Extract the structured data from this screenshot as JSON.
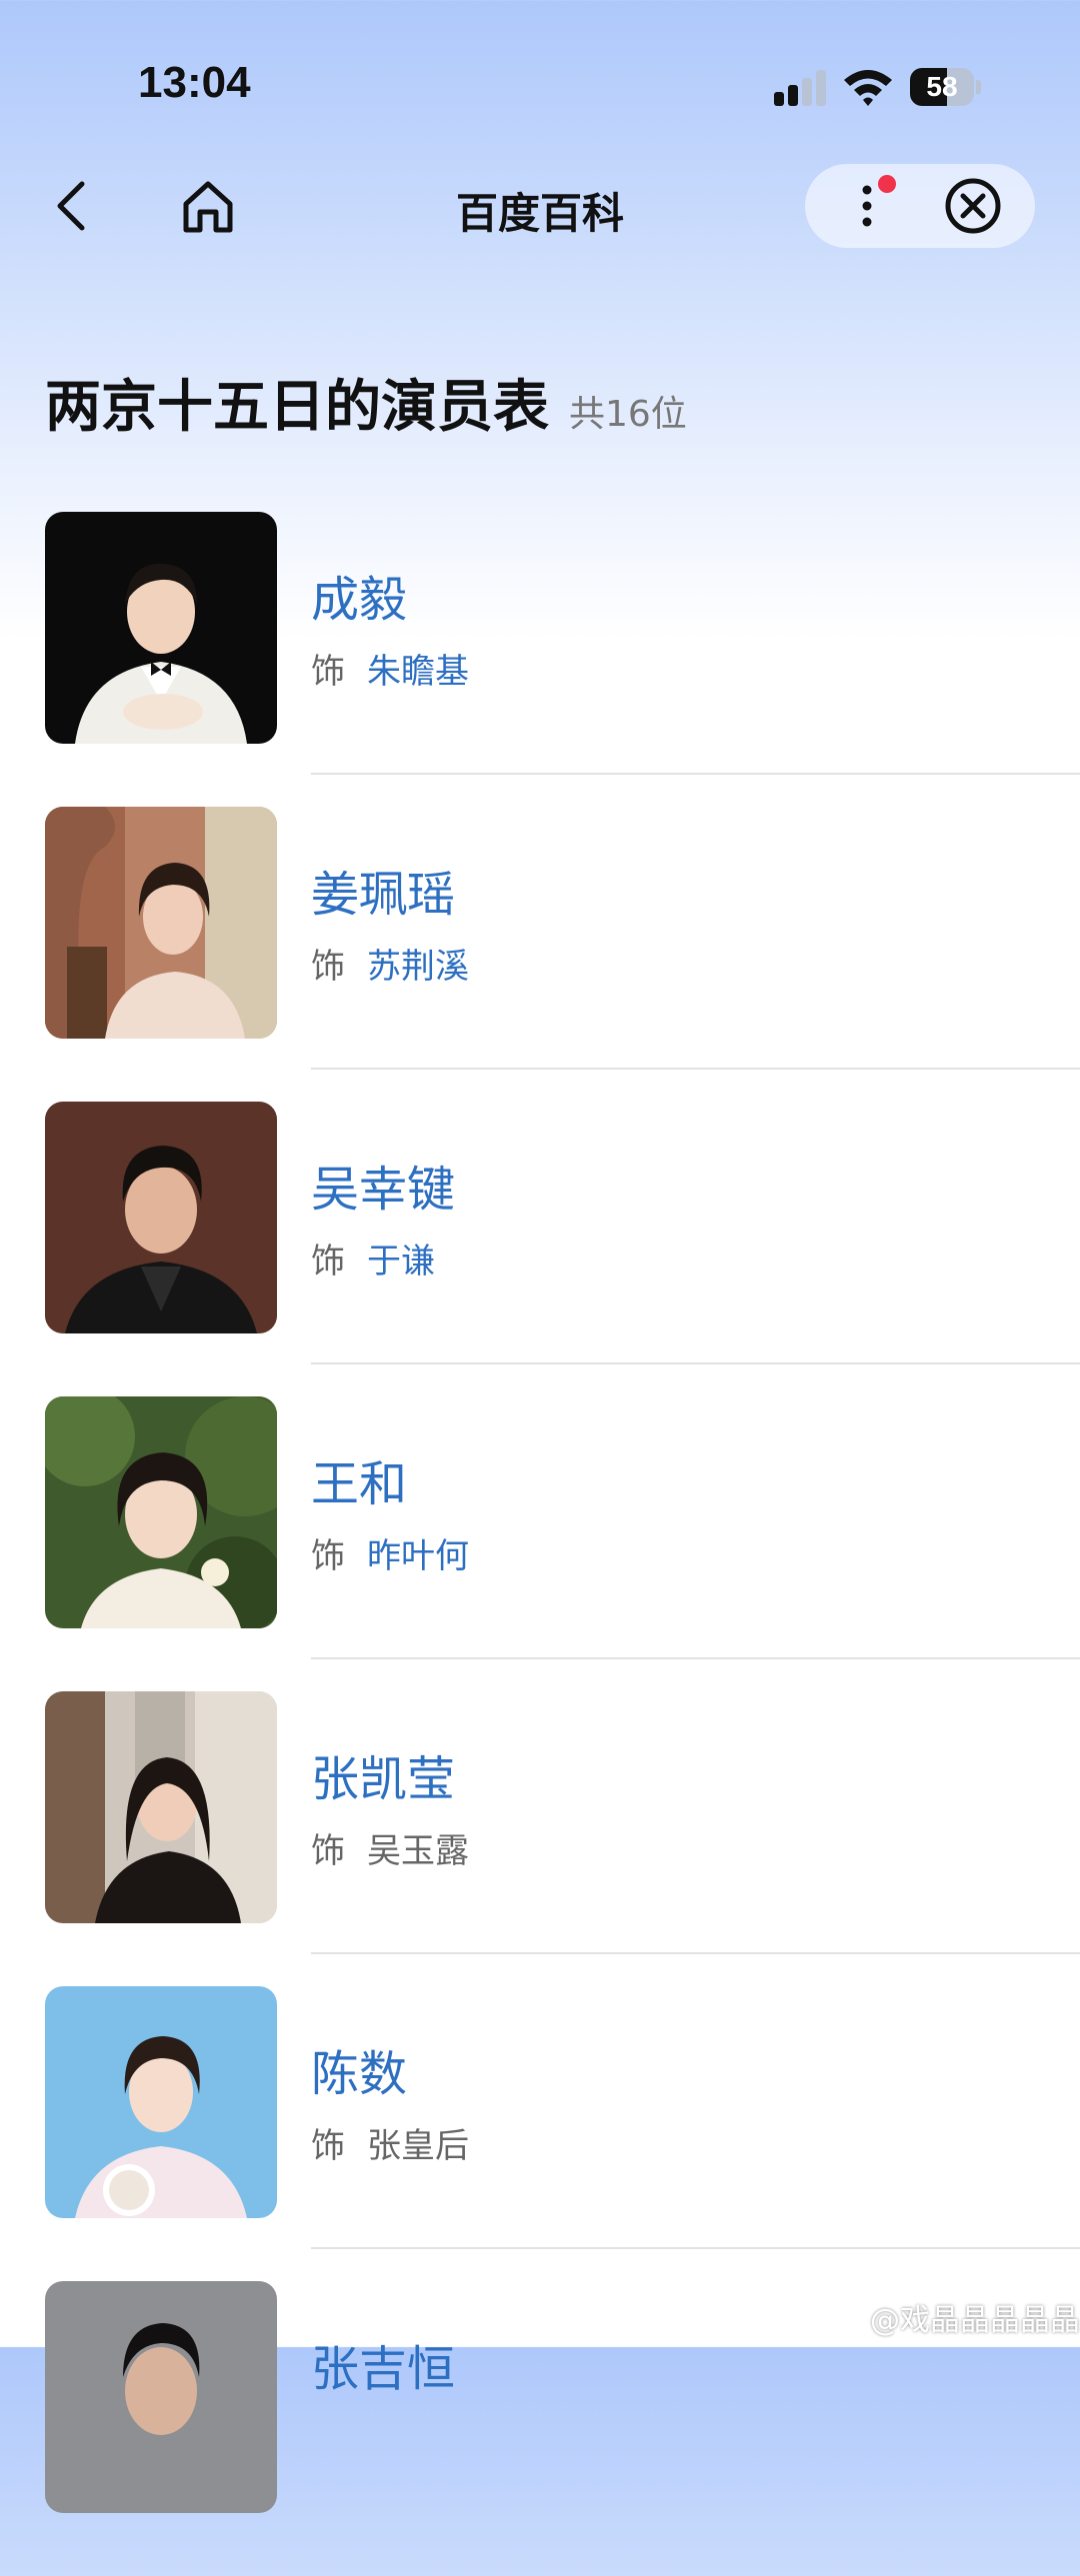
{
  "status_bar": {
    "time": "13:04",
    "battery_level": "58",
    "battery_fraction": 0.58
  },
  "nav": {
    "title": "百度百科",
    "icons": {
      "back": "chevron-left-icon",
      "home": "home-icon",
      "more": "more-vertical-icon",
      "close": "close-circle-icon"
    },
    "notification_dot_color": "#f0334b"
  },
  "page": {
    "title": "两京十五日的演员表",
    "count": "共16位"
  },
  "cast": [
    {
      "actor": "成毅",
      "role_prefix": "饰",
      "role": "朱瞻基",
      "role_linked": true
    },
    {
      "actor": "姜珮瑶",
      "role_prefix": "饰",
      "role": "苏荆溪",
      "role_linked": true
    },
    {
      "actor": "吴幸键",
      "role_prefix": "饰",
      "role": "于谦",
      "role_linked": true
    },
    {
      "actor": "王和",
      "role_prefix": "饰",
      "role": "昨叶何",
      "role_linked": true
    },
    {
      "actor": "张凯莹",
      "role_prefix": "饰",
      "role": "吴玉露",
      "role_linked": false
    },
    {
      "actor": "陈数",
      "role_prefix": "饰",
      "role": "张皇后",
      "role_linked": false
    },
    {
      "actor": "张吉恒",
      "role_prefix": "",
      "role": "",
      "role_linked": false
    }
  ],
  "watermark": "@戏晶晶晶晶晶晶",
  "colors": {
    "link_blue": "#2d6fc1",
    "muted_text": "#666666",
    "divider": "#e2e2e2"
  }
}
